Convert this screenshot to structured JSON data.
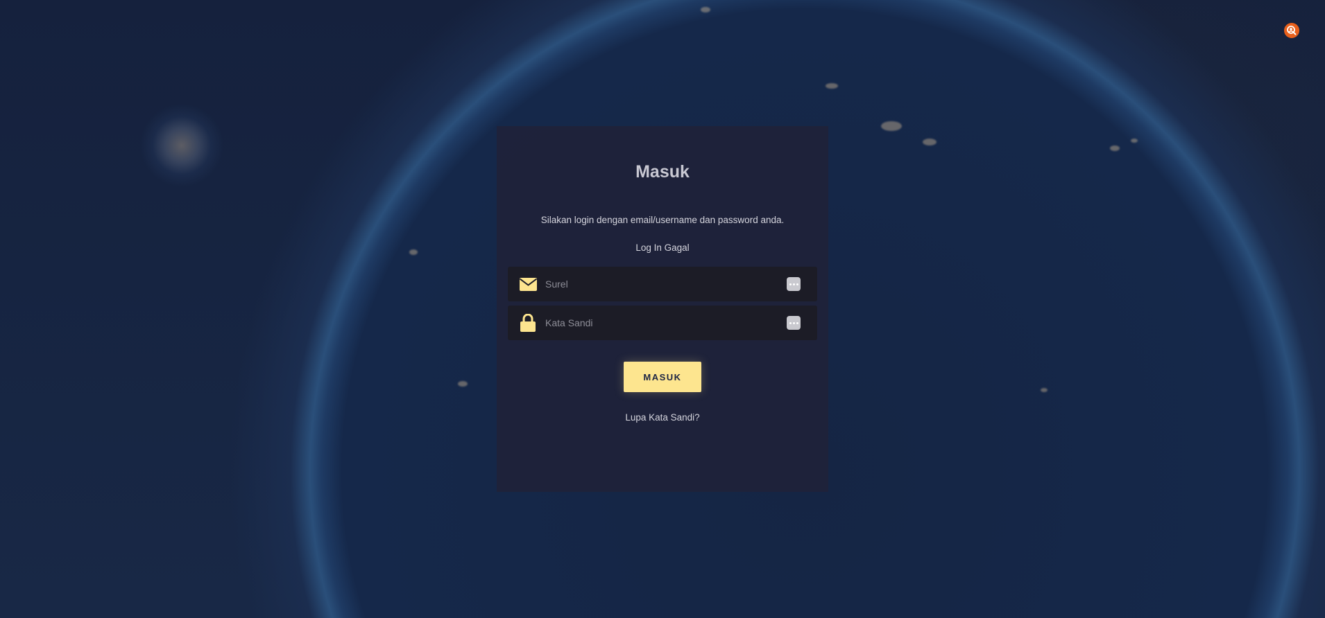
{
  "login": {
    "title": "Masuk",
    "subtitle": "Silakan login dengan email/username dan password anda.",
    "error_message": "Log In Gagal",
    "email": {
      "placeholder": "Surel",
      "value": "",
      "icon": "envelope-icon"
    },
    "password": {
      "placeholder": "Kata Sandi",
      "value": "",
      "icon": "lock-icon"
    },
    "submit_label": "MASUK",
    "forgot_label": "Lupa Kata Sandi?"
  },
  "colors": {
    "accent": "#fde58f",
    "icon_accent": "#fde58f",
    "profile_button": "#e8601c",
    "card_background": "#20223a",
    "field_background": "#1c1c26",
    "page_background": "#17233f"
  },
  "header": {
    "profile_icon": "user-search-icon"
  }
}
